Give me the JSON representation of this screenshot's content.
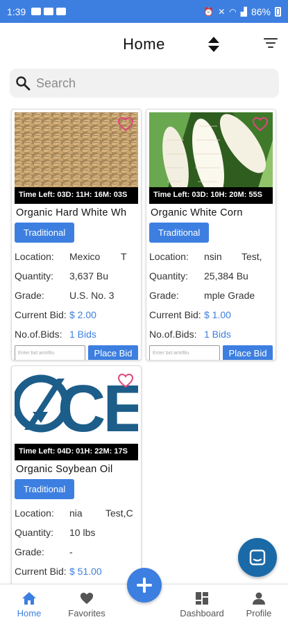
{
  "status_bar": {
    "time": "1:39",
    "battery": "86%"
  },
  "header": {
    "title": "Home"
  },
  "search": {
    "placeholder": "Search"
  },
  "products": [
    {
      "name": "Organic Hard White Wh",
      "time_left": "Time Left: 03D: 11H: 16M: 03S",
      "badge": "Traditional",
      "location_label": "Location:",
      "location_city": "Mexico",
      "location_state": "T",
      "quantity_label": "Quantity:",
      "quantity": "3,637 Bu",
      "grade_label": "Grade:",
      "grade": "U.S. No. 3",
      "current_bid_label": "Current Bid:",
      "current_bid": "$ 2.00",
      "bids_label": "No.of.Bids:",
      "bids": "1 Bids",
      "bid_placeholder": "Enter bid amt/Bu",
      "place_bid": "Place Bid"
    },
    {
      "name": "Organic White Corn",
      "time_left": "Time Left: 03D: 10H: 20M: 55S",
      "badge": "Traditional",
      "location_label": "Location:",
      "location_city": "nsin",
      "location_state": "Test,",
      "quantity_label": "Quantity:",
      "quantity": "25,384 Bu",
      "grade_label": "Grade:",
      "grade": "mple Grade",
      "current_bid_label": "Current Bid:",
      "current_bid": "$ 1.00",
      "bids_label": "No.of.Bids:",
      "bids": "1 Bids",
      "bid_placeholder": "Enter bid amt/Bu",
      "place_bid": "Place Bid"
    },
    {
      "name": "Organic Soybean Oil",
      "time_left": "Time Left: 04D: 01H: 22M: 17S",
      "badge": "Traditional",
      "logo_text": "CE",
      "location_label": "Location:",
      "location_city": "nia",
      "location_state": "Test,C",
      "quantity_label": "Quantity:",
      "quantity": "10 lbs",
      "grade_label": "Grade:",
      "grade": "-",
      "current_bid_label": "Current Bid:",
      "current_bid": "$ 51.00"
    }
  ],
  "nav": {
    "home": "Home",
    "favorites": "Favorites",
    "dashboard": "Dashboard",
    "profile": "Profile"
  },
  "colors": {
    "accent": "#3d7fe0",
    "heart": "#e0457b",
    "chat": "#1a6aa8"
  }
}
